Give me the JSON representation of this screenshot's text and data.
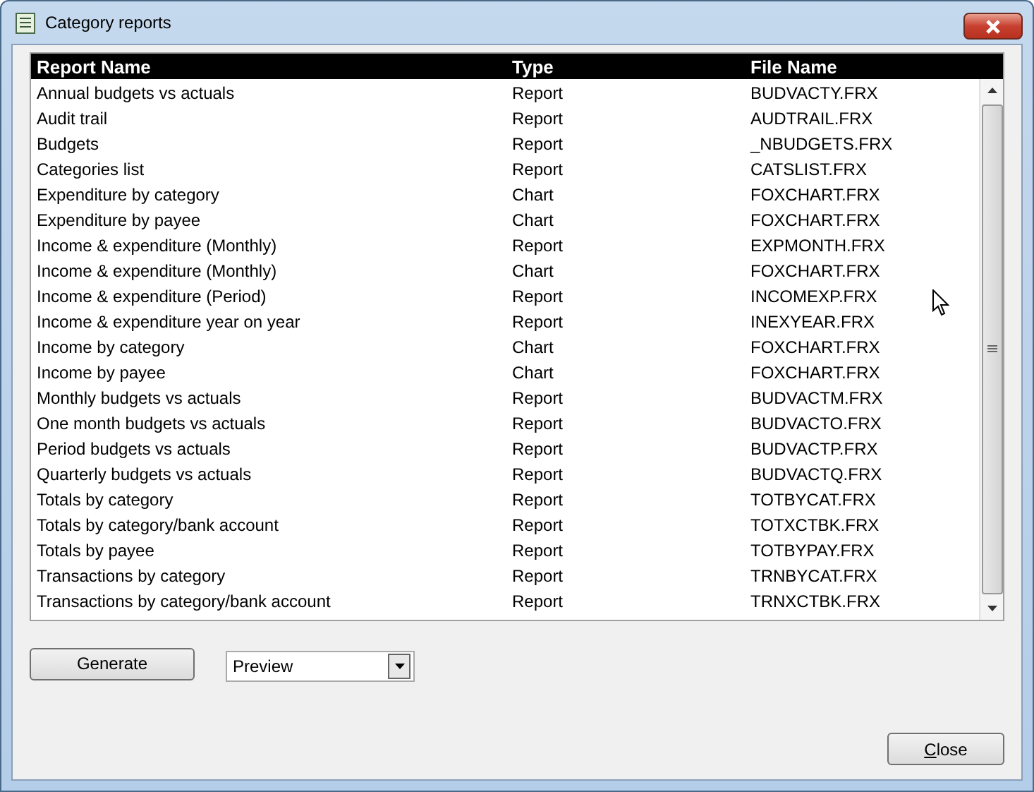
{
  "window": {
    "title": "Category reports"
  },
  "table": {
    "columns": [
      "Report Name",
      "Type",
      "File Name"
    ],
    "rows": [
      [
        "Annual budgets vs actuals",
        "Report",
        "BUDVACTY.FRX"
      ],
      [
        "Audit trail",
        "Report",
        "AUDTRAIL.FRX"
      ],
      [
        "Budgets",
        "Report",
        "_NBUDGETS.FRX"
      ],
      [
        "Categories list",
        "Report",
        "CATSLIST.FRX"
      ],
      [
        "Expenditure by category",
        "Chart",
        "FOXCHART.FRX"
      ],
      [
        "Expenditure by payee",
        "Chart",
        "FOXCHART.FRX"
      ],
      [
        "Income & expenditure (Monthly)",
        "Report",
        "EXPMONTH.FRX"
      ],
      [
        "Income & expenditure (Monthly)",
        "Chart",
        "FOXCHART.FRX"
      ],
      [
        "Income & expenditure (Period)",
        "Report",
        "INCOMEXP.FRX"
      ],
      [
        "Income & expenditure year on year",
        "Report",
        "INEXYEAR.FRX"
      ],
      [
        "Income by category",
        "Chart",
        "FOXCHART.FRX"
      ],
      [
        "Income by payee",
        "Chart",
        "FOXCHART.FRX"
      ],
      [
        "Monthly budgets vs actuals",
        "Report",
        "BUDVACTM.FRX"
      ],
      [
        "One month budgets vs actuals",
        "Report",
        "BUDVACTO.FRX"
      ],
      [
        "Period budgets vs actuals",
        "Report",
        "BUDVACTP.FRX"
      ],
      [
        "Quarterly budgets vs actuals",
        "Report",
        "BUDVACTQ.FRX"
      ],
      [
        "Totals by category",
        "Report",
        "TOTBYCAT.FRX"
      ],
      [
        "Totals by category/bank account",
        "Report",
        "TOTXCTBK.FRX"
      ],
      [
        "Totals by payee",
        "Report",
        "TOTBYPAY.FRX"
      ],
      [
        "Transactions by category",
        "Report",
        "TRNBYCAT.FRX"
      ],
      [
        "Transactions by category/bank account",
        "Report",
        "TRNXCTBK.FRX"
      ]
    ]
  },
  "generate_button": "Generate",
  "output_select": {
    "value": "Preview"
  },
  "close_button": "Close"
}
